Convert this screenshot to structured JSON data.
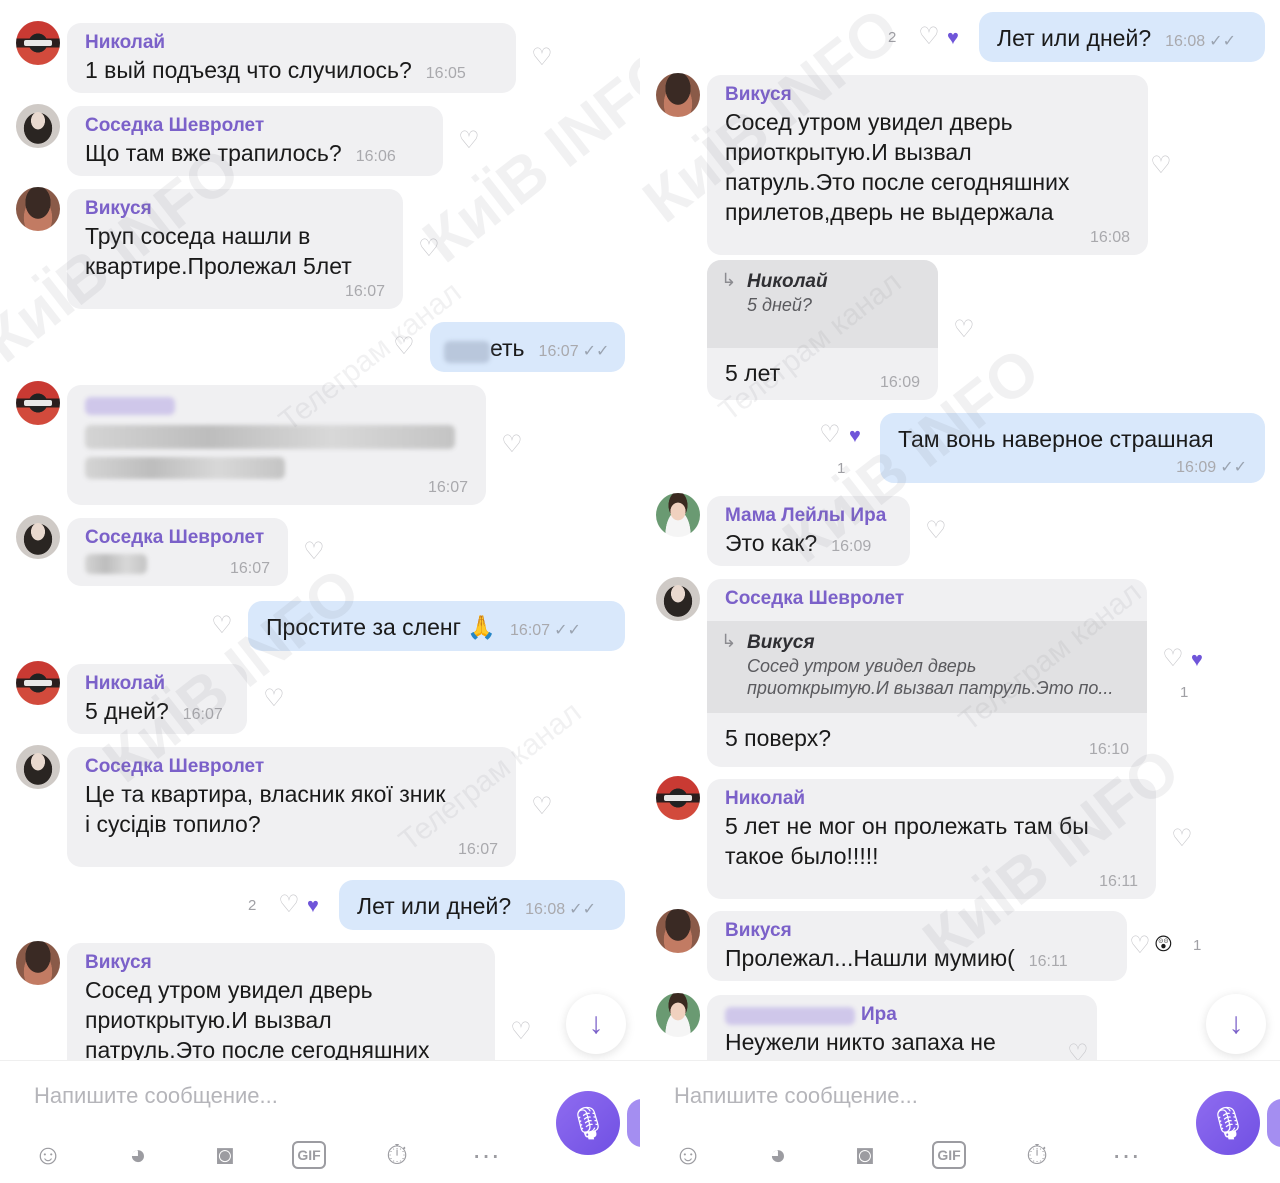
{
  "left": {
    "messages": [
      {
        "sender": "Николай",
        "text": "1 вый подъезд что случилось?",
        "time": "16:05"
      },
      {
        "sender": "Соседка Шевролет",
        "text": "Що там вже трапилось?",
        "time": "16:06"
      },
      {
        "sender": "Викуся",
        "text_lines": [
          "Труп соседа нашли в",
          "квартире.Пролежал 5лет"
        ],
        "time": "16:07"
      },
      {
        "text_visible": "еть",
        "time": "16:07",
        "ticks": "✓✓"
      },
      {
        "time": "16:07"
      },
      {
        "sender": "Соседка Шевролет",
        "time": "16:07"
      },
      {
        "text": "Простите за сленг 🙏",
        "time": "16:07",
        "ticks": "✓✓"
      },
      {
        "sender": "Николай",
        "text": "5 дней?",
        "time": "16:07"
      },
      {
        "sender": "Соседка Шевролет",
        "text_lines": [
          "Це та квартира, власник якої зник",
          "і сусідів топило?"
        ],
        "time": "16:07"
      },
      {
        "text": "Лет или дней?",
        "time": "16:08",
        "ticks": "✓✓",
        "like_count": "2"
      },
      {
        "sender": "Викуся",
        "text_lines": [
          "Сосед утром увидел дверь",
          "приоткрытую.И вызвал",
          "патруль.Это после сегодняшних"
        ]
      }
    ],
    "composer_placeholder": "Напишите сообщение..."
  },
  "right": {
    "messages": [
      {
        "text": "Лет или дней?",
        "time": "16:08",
        "ticks": "✓✓",
        "like_count": "2"
      },
      {
        "sender": "Викуся",
        "text_lines": [
          "Сосед утром увидел дверь",
          "приоткрытую.И вызвал",
          "патруль.Это после сегодняшних",
          "прилетов,дверь не выдержала"
        ],
        "time": "16:08"
      },
      {
        "reply_name": "Николай",
        "reply_text": "5 дней?",
        "text": "5 лет",
        "time": "16:09"
      },
      {
        "text": "Там вонь наверное страшная",
        "time": "16:09",
        "ticks": "✓✓",
        "like_count": "1"
      },
      {
        "sender": "Мама Лейлы Ира",
        "text": "Это как?",
        "time": "16:09"
      },
      {
        "sender": "Соседка Шевролет",
        "reply_name": "Викуся",
        "reply_lines": [
          "Сосед утром увидел дверь",
          "приоткрытую.И вызвал патруль.Это по..."
        ],
        "text": "5 поверх?",
        "time": "16:10",
        "like_count": "1"
      },
      {
        "sender": "Николай",
        "text_lines": [
          "5 лет не мог он пролежать там бы",
          "такое было!!!!!"
        ],
        "time": "16:11"
      },
      {
        "sender": "Викуся",
        "text": "Пролежал...Нашли мумию(",
        "time": "16:11",
        "reaction": "😲",
        "like_count": "1"
      },
      {
        "sender_visible": "Ира",
        "text": "Неужели никто запаха не"
      }
    ],
    "composer_placeholder": "Напишите сообщение..."
  },
  "icons": {
    "like": "heart-icon",
    "mic": "microphone-icon",
    "scroll": "arrow-down-icon",
    "sticker": "sticker-icon",
    "emoji": "emoji-icon",
    "camera": "camera-icon",
    "gif": "gif-icon",
    "timer": "timer-icon",
    "more": "more-icon"
  },
  "gif_label": "GIF",
  "watermark": {
    "big": "КиЇВ INFO",
    "small": "Телеграм канал"
  },
  "colors": {
    "accent": "#7b61c9",
    "incoming_bubble": "#f0f0f2",
    "outgoing_bubble": "#d9e8fb",
    "reaction": "#6f55d9"
  }
}
